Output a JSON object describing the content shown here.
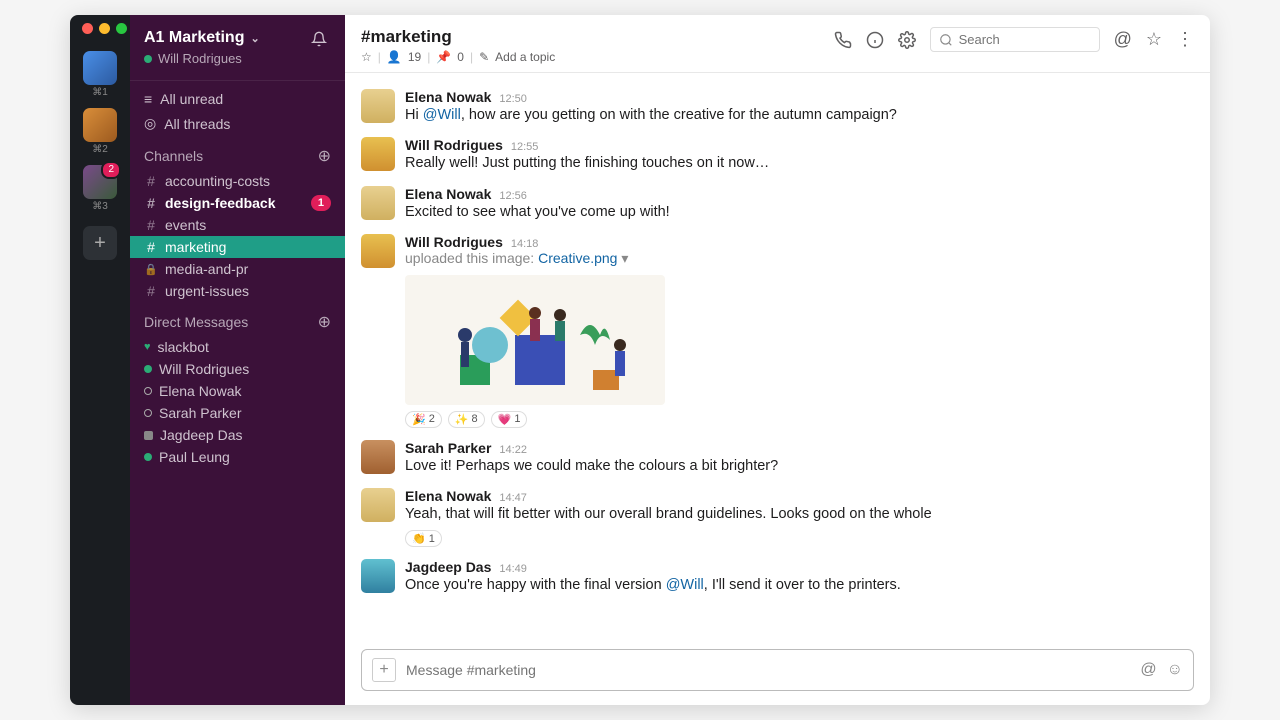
{
  "workspace": {
    "name": "A1 Marketing",
    "current_user": "Will Rodrigues"
  },
  "rail": {
    "items": [
      {
        "shortcut": "⌘1",
        "badge": null
      },
      {
        "shortcut": "⌘2",
        "badge": null
      },
      {
        "shortcut": "⌘3",
        "badge": "2"
      }
    ]
  },
  "sidebar": {
    "all_unread": "All unread",
    "all_threads": "All threads",
    "channels_header": "Channels",
    "channels": [
      {
        "name": "accounting-costs",
        "private": false,
        "bold": false,
        "badge": null,
        "active": false
      },
      {
        "name": "design-feedback",
        "private": false,
        "bold": true,
        "badge": "1",
        "active": false
      },
      {
        "name": "events",
        "private": false,
        "bold": false,
        "badge": null,
        "active": false
      },
      {
        "name": "marketing",
        "private": false,
        "bold": false,
        "badge": null,
        "active": true
      },
      {
        "name": "media-and-pr",
        "private": true,
        "bold": false,
        "badge": null,
        "active": false
      },
      {
        "name": "urgent-issues",
        "private": false,
        "bold": false,
        "badge": null,
        "active": false
      }
    ],
    "dms_header": "Direct Messages",
    "dms": [
      {
        "name": "slackbot",
        "status": "heart"
      },
      {
        "name": "Will Rodrigues",
        "status": "online"
      },
      {
        "name": "Elena Nowak",
        "status": "away"
      },
      {
        "name": "Sarah Parker",
        "status": "away"
      },
      {
        "name": "Jagdeep Das",
        "status": "square"
      },
      {
        "name": "Paul Leung",
        "status": "online"
      }
    ]
  },
  "channel": {
    "title": "#marketing",
    "star": "☆",
    "members_icon": "👤",
    "members": "19",
    "pins": "0",
    "add_topic": "Add a topic",
    "search_placeholder": "Search"
  },
  "messages": [
    {
      "author": "Elena Nowak",
      "time": "12:50",
      "avatar": "av-elena",
      "text_before": "Hi ",
      "mention": "@Will",
      "text_after": ", how are you getting on with the creative for the autumn campaign?"
    },
    {
      "author": "Will Rodrigues",
      "time": "12:55",
      "avatar": "av-will",
      "text": "Really well! Just putting the finishing touches on it now…"
    },
    {
      "author": "Elena Nowak",
      "time": "12:56",
      "avatar": "av-elena",
      "text": "Excited to see what you've come up with!"
    },
    {
      "author": "Will Rodrigues",
      "time": "14:18",
      "avatar": "av-will",
      "upload_prefix": "uploaded this image: ",
      "upload_name": "Creative.png",
      "reactions": [
        {
          "emoji": "🎉",
          "count": "2"
        },
        {
          "emoji": "✨",
          "count": "8"
        },
        {
          "emoji": "💗",
          "count": "1"
        }
      ]
    },
    {
      "author": "Sarah Parker",
      "time": "14:22",
      "avatar": "av-sarah",
      "text": "Love it! Perhaps we could make the colours a bit brighter?"
    },
    {
      "author": "Elena Nowak",
      "time": "14:47",
      "avatar": "av-elena",
      "text": "Yeah, that will fit better with our overall brand guidelines. Looks good on the whole",
      "reactions": [
        {
          "emoji": "👏",
          "count": "1"
        }
      ]
    },
    {
      "author": "Jagdeep Das",
      "time": "14:49",
      "avatar": "av-jagdeep",
      "text_before": "Once you're happy with the final version ",
      "mention": "@Will",
      "text_after": ", I'll send it over to the printers."
    }
  ],
  "composer": {
    "placeholder": "Message #marketing"
  }
}
